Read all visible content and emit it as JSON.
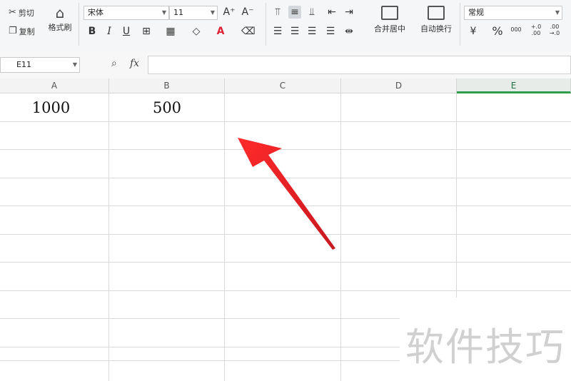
{
  "clipboard": {
    "cut_label": "剪切",
    "copy_label": "复制",
    "format_painter_label": "格式刷"
  },
  "font": {
    "name": "宋体",
    "size": "11",
    "bold": "B",
    "italic": "I",
    "underline": "U",
    "font_color_glyph": "A"
  },
  "alignment": {
    "merge_label": "合并居中",
    "wrap_label": "自动换行"
  },
  "number": {
    "format": "常规",
    "percent_glyph": "%",
    "thousands_glyph": "000",
    "inc_decimal_glyph": "+.0\n.00",
    "dec_decimal_glyph": ".00\n→.0"
  },
  "formula_bar": {
    "name_box": "E11",
    "fx": "fx",
    "formula": ""
  },
  "columns": [
    "A",
    "B",
    "C",
    "D",
    "E"
  ],
  "selected_column": "E",
  "cells": {
    "A1": "1000",
    "B1": "500"
  },
  "watermark": "软件技巧",
  "arrow_color": "#e8242a",
  "selection_color": "#2e9e4e"
}
